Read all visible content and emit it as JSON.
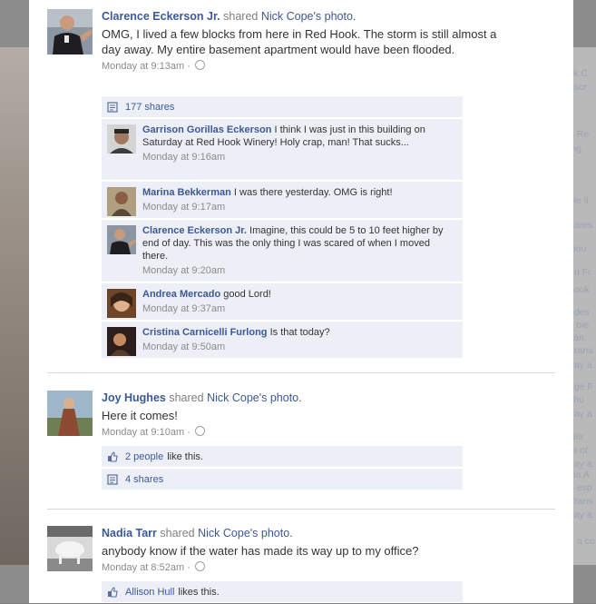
{
  "posts": [
    {
      "author": "Clarence Eckerson Jr.",
      "action": "shared",
      "owner": "Nick Cope's",
      "object": "photo.",
      "message": "OMG, I lived a few blocks from here in Red Hook. The storm is still almost a day away. My entire basement apartment would have been flooded.",
      "time": "Monday at 9:13am",
      "shares": "177 shares",
      "comments": [
        {
          "name": "Garrison Gorillas Eckerson",
          "text": "I think I was just in this building on Saturday at Red Hook Winery! Holy crap, man! That sucks...",
          "time": "Monday at 9:16am"
        },
        {
          "name": "Marina Bekkerman",
          "text": "I was there yesterday. OMG is right!",
          "time": "Monday at 9:17am"
        },
        {
          "name": "Clarence Eckerson Jr.",
          "text": "Imagine, this could be 5 to 10 feet higher by end of day. This was the only thing I was scared of when I moved there.",
          "time": "Monday at 9:20am"
        },
        {
          "name": "Andrea Mercado",
          "text": "good Lord!",
          "time": "Monday at 9:37am"
        },
        {
          "name": "Cristina Carnicelli Furlong",
          "text": "Is that today?",
          "time": "Monday at 9:50am"
        }
      ]
    },
    {
      "author": "Joy Hughes",
      "action": "shared",
      "owner": "Nick Cope's",
      "object": "photo.",
      "message": "Here it comes!",
      "time": "Monday at 9:10am",
      "likes_link": "2 people",
      "likes_text": "like this.",
      "shares": "4 shares"
    },
    {
      "author": "Nadia Tarr",
      "action": "shared",
      "owner": "Nick Cope's",
      "object": "photo.",
      "message": "anybody know if the water has made its way up to my office?",
      "time": "Monday at 8:52am",
      "likes_link": "Allison Hull",
      "likes_text": "likes this."
    }
  ],
  "meta_separator": "·",
  "icons": {
    "share": "share-icon",
    "like": "thumbs-up-icon",
    "audience": "globe-icon"
  },
  "background_fragments": [
    "ck C",
    "bscr",
    "n Re",
    "ing.",
    "ple li",
    "hares",
    "viou",
    "en Fr",
    "book",
    "edes",
    "s bie",
    "cán.",
    "Trans",
    "day a",
    "age F",
    "i ho",
    "day a",
    "Nitr",
    "ur of",
    "day a",
    "cia A",
    "o esp",
    "Trans",
    "day a",
    "e a co"
  ],
  "colors": {
    "link": "#3b5998",
    "ufi_background": "#eceff5",
    "meta": "#8b8b8b"
  }
}
